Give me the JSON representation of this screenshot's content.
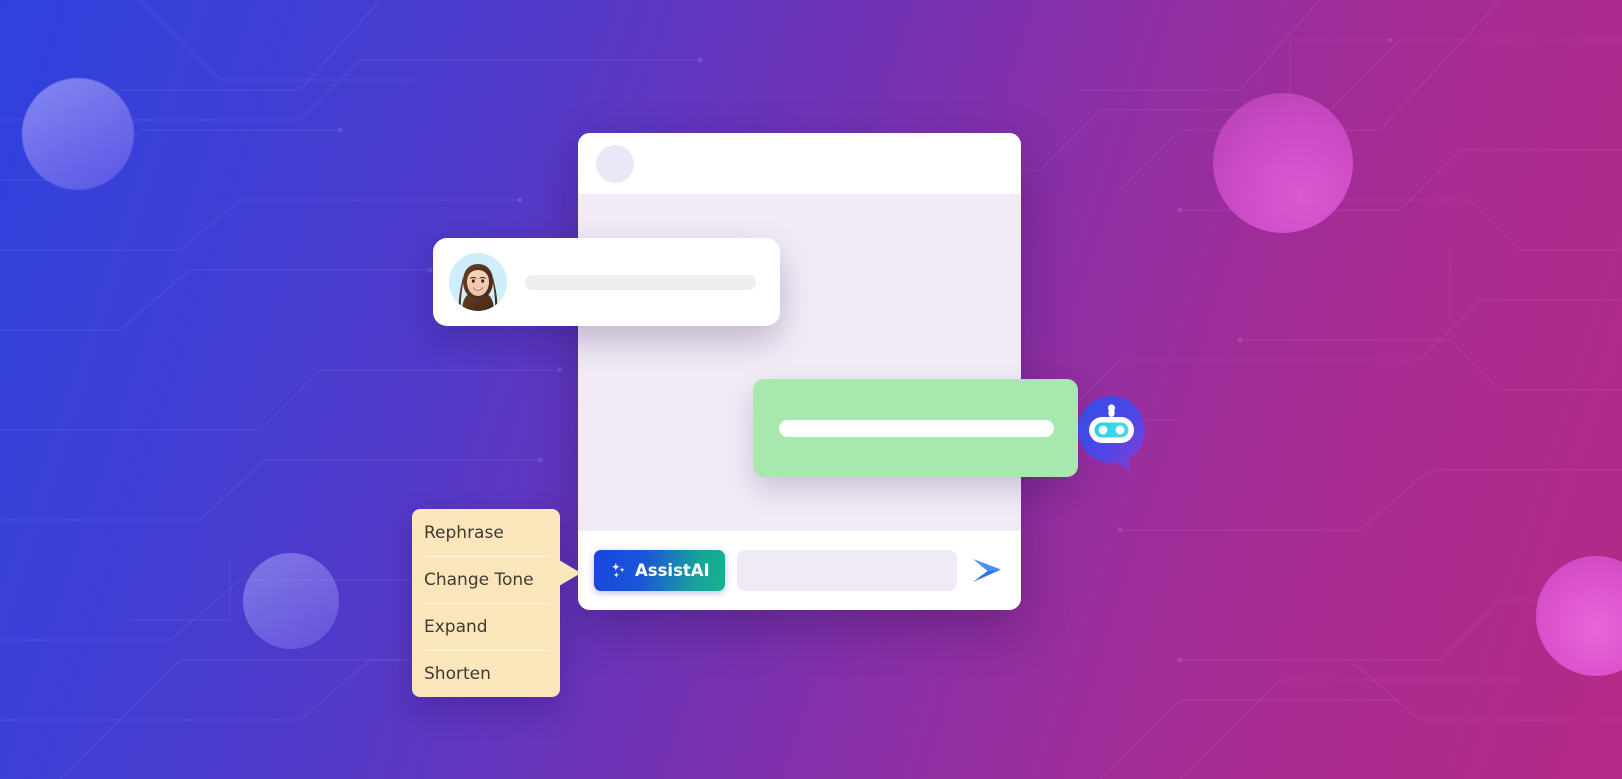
{
  "background": {
    "gradient_from": "#2f41dd",
    "gradient_mid": "#6b33b8",
    "gradient_to": "#b52a86",
    "pattern": "circuit-traces",
    "orbs": [
      {
        "name": "orb-top-left",
        "color": "#8f86f5"
      },
      {
        "name": "orb-bottom-left",
        "color": "#9a92f7"
      },
      {
        "name": "orb-top-right",
        "color": "#e158db"
      },
      {
        "name": "orb-bottom-right",
        "color": "#e85ddf"
      }
    ]
  },
  "chat_window": {
    "header": {
      "avatar_icon": "avatar-placeholder-circle"
    },
    "footer": {
      "assist_button_label": "AssistAI",
      "assist_button_icon": "sparkles-icon",
      "assist_button_gradient_from": "#1746e0",
      "assist_button_gradient_to": "#12b48c",
      "input_placeholder": "",
      "input_value": "",
      "send_icon": "send-paper-plane-icon",
      "send_icon_color": "#3b82f6"
    }
  },
  "user_message": {
    "avatar_icon": "user-avatar-photo",
    "avatar_background": "#cfeefb",
    "text_placeholder": ""
  },
  "bot_message": {
    "bubble_color": "#a6e8ae",
    "text_placeholder": "",
    "badge_icon": "robot-chat-bubble-icon",
    "badge_gradient_from": "#3b5bdb",
    "badge_gradient_to": "#7c3aed",
    "badge_eye_color": "#22d3ee"
  },
  "assist_menu": {
    "background": "#fbe6bc",
    "items": [
      {
        "label": "Rephrase"
      },
      {
        "label": "Change Tone"
      },
      {
        "label": "Expand"
      },
      {
        "label": "Shorten"
      }
    ]
  }
}
